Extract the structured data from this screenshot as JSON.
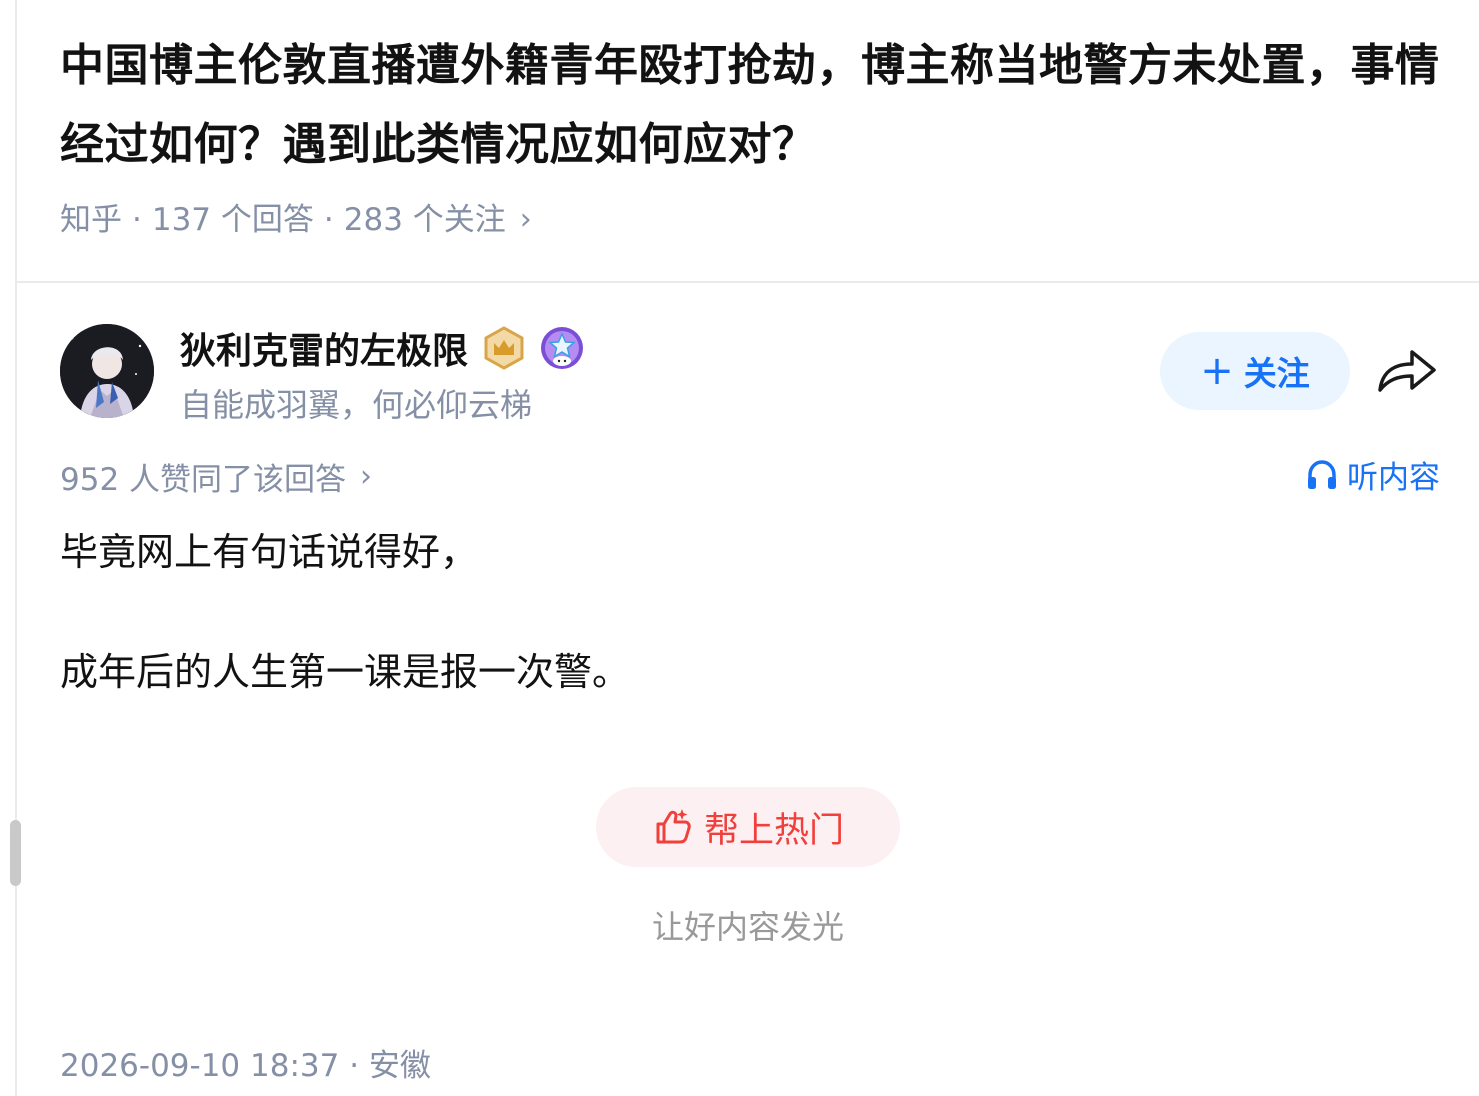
{
  "question": {
    "title": "中国博主伦敦直播遭外籍青年殴打抢劫，博主称当地警方未处置，事情经过如何？遇到此类情况应如何应对？",
    "source": "知乎",
    "answers": "137 个回答",
    "followers": "283 个关注"
  },
  "author": {
    "name": "狄利克雷的左极限",
    "bio": "自能成羽翼，何必仰云梯",
    "follow_label": "关注",
    "badges": [
      "crown-badge-icon",
      "star-badge-icon"
    ]
  },
  "answer": {
    "votes": "952 人赞同了该回答",
    "listen_label": "听内容",
    "paragraphs": [
      "毕竟网上有句话说得好，",
      "成年后的人生第一课是报一次警。"
    ],
    "hot_button": "帮上热门",
    "hot_sub": "让好内容发光",
    "time_location": "2026-09-10 18:37 · 安徽"
  },
  "colors": {
    "accent_blue": "#1772f6",
    "follow_bg": "#ebf5ff",
    "meta_gray": "#8590a6",
    "hot_red": "#f1403c",
    "hot_bg": "#fdf0f2"
  }
}
